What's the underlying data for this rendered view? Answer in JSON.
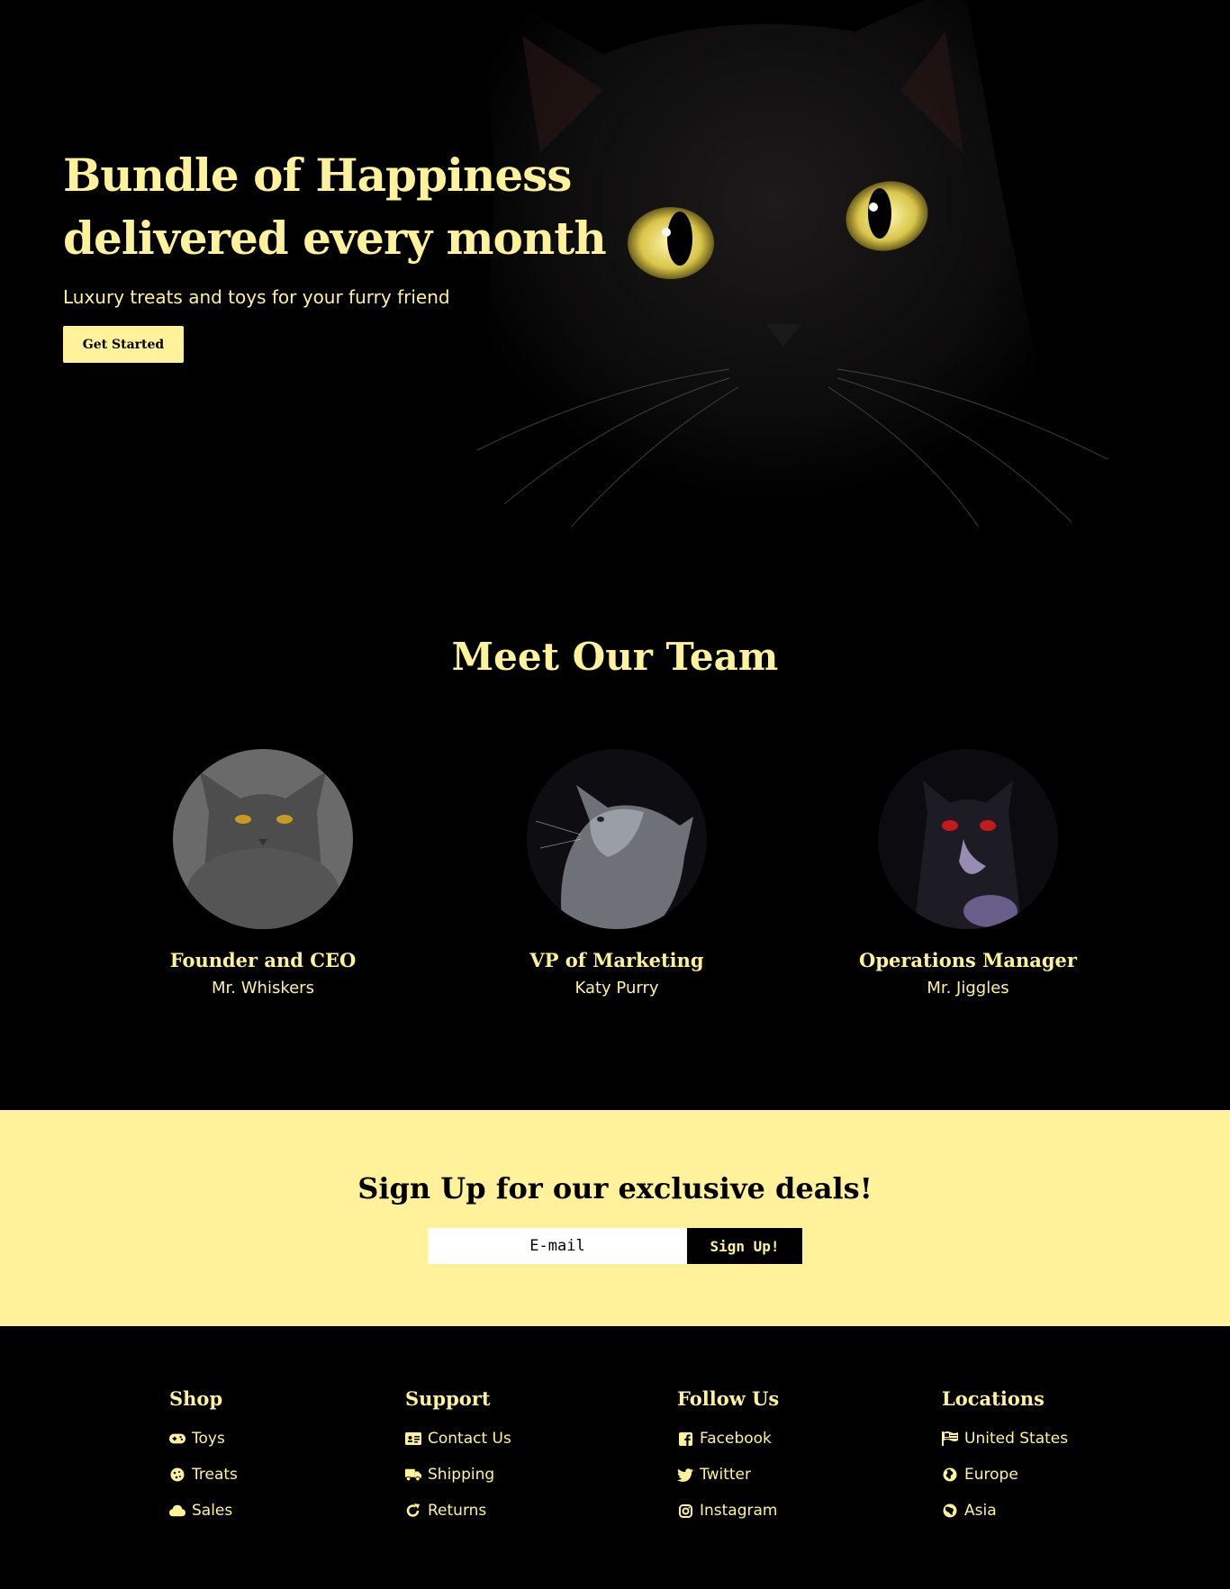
{
  "hero": {
    "title": "Bundle of Happiness\ndelivered every month",
    "subtitle": "Luxury treats and toys for your furry friend",
    "cta_label": "Get Started"
  },
  "team": {
    "title": "Meet Our Team",
    "members": [
      {
        "role": "Founder and CEO",
        "name": "Mr. Whiskers"
      },
      {
        "role": "VP of Marketing",
        "name": "Katy Purry"
      },
      {
        "role": "Operations Manager",
        "name": "Mr. Jiggles"
      }
    ]
  },
  "signup": {
    "title": "Sign Up for our exclusive deals!",
    "email_placeholder": "E-mail",
    "button_label": "Sign Up!"
  },
  "footer": {
    "columns": [
      {
        "title": "Shop",
        "items": [
          {
            "label": "Toys",
            "icon": "gamepad-icon"
          },
          {
            "label": "Treats",
            "icon": "cookie-icon"
          },
          {
            "label": "Sales",
            "icon": "cloud-icon"
          }
        ]
      },
      {
        "title": "Support",
        "items": [
          {
            "label": "Contact Us",
            "icon": "contact-card-icon"
          },
          {
            "label": "Shipping",
            "icon": "truck-icon"
          },
          {
            "label": "Returns",
            "icon": "redo-icon"
          }
        ]
      },
      {
        "title": "Follow Us",
        "items": [
          {
            "label": "Facebook",
            "icon": "facebook-icon"
          },
          {
            "label": "Twitter",
            "icon": "twitter-icon"
          },
          {
            "label": "Instagram",
            "icon": "instagram-icon"
          }
        ]
      },
      {
        "title": "Locations",
        "items": [
          {
            "label": "United States",
            "icon": "flag-usa-icon"
          },
          {
            "label": "Europe",
            "icon": "globe-europe-icon"
          },
          {
            "label": "Asia",
            "icon": "globe-asia-icon"
          }
        ]
      }
    ]
  },
  "colors": {
    "accent": "#fff29a",
    "background": "#000000",
    "dark_text": "#000000"
  }
}
